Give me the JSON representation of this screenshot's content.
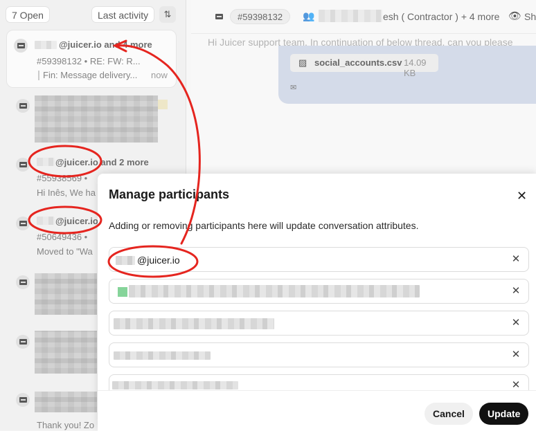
{
  "inbox": {
    "open_label": "7 Open",
    "sort_label": "Last activity",
    "sort_icon": "sort-icon",
    "items": [
      {
        "sender": "@juicer.io and 4 more",
        "ticket": "#59398132 • RE: FW: R...",
        "preview": "Fin: Message delivery...",
        "time": "now"
      },
      {
        "sender": "@juicer.io and 2 more",
        "ticket": "#55938569 •",
        "preview": "Hi Inês, We ha"
      },
      {
        "sender": "@juicer.io",
        "ticket": "#50649436 •",
        "preview": "Moved to \"Wa"
      },
      {
        "sender": "",
        "ticket": "",
        "preview": "Thank you! Zo"
      }
    ]
  },
  "thread": {
    "ticket_id": "#59398132",
    "participants_summary": "esh ( Contractor ) + 4 more",
    "eye_label": "Sh",
    "preview": "Hi Juicer support team, In continuation of below thread, can you please",
    "attachment": {
      "name": "social_accounts.csv",
      "size": "14.09 KB"
    }
  },
  "modal": {
    "title": "Manage participants",
    "description": "Adding or removing participants here will update conversation attributes.",
    "participants": [
      "@juicer.io",
      "",
      "",
      "",
      ""
    ],
    "cancel_label": "Cancel",
    "update_label": "Update",
    "close_icon": "close-icon"
  },
  "colors": {
    "annotation": "#e5251f",
    "primary_button": "#111111"
  }
}
